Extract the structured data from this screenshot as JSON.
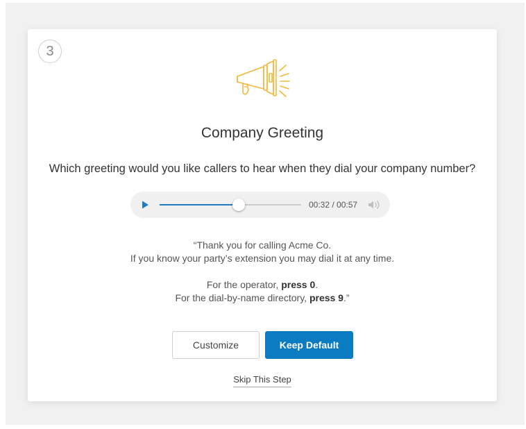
{
  "step": {
    "number": "3"
  },
  "icon": {
    "name": "megaphone-icon",
    "color": "#f4b83a"
  },
  "greeting": {
    "title": "Company Greeting",
    "question": "Which greeting would you like callers to hear when they dial your company number?"
  },
  "player": {
    "elapsed": "00:32",
    "duration": "00:57",
    "time_text": "00:32 / 00:57",
    "progress": 0.56,
    "accent_color": "#1e7ac2"
  },
  "script": {
    "line1": "“Thank you for calling Acme Co.",
    "line2": "If you know your party’s extension you may dial it at any time.",
    "line3_prefix": "For the operator, ",
    "line3_bold": "press 0",
    "line3_suffix": ".",
    "line4_prefix": "For the dial-by-name directory, ",
    "line4_bold": "press 9",
    "line4_suffix": ".”"
  },
  "actions": {
    "customize_label": "Customize",
    "keep_default_label": "Keep Default",
    "keep_default_color": "#0b7cc2",
    "skip_label": "Skip This Step"
  }
}
